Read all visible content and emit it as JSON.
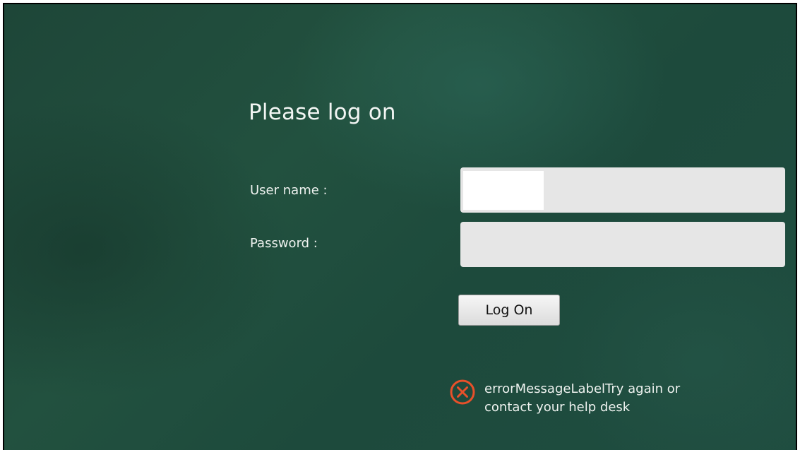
{
  "login": {
    "title": "Please log on",
    "username_label": "User name :",
    "password_label": "Password :",
    "username_value": "",
    "password_value": "",
    "logon_button_label": "Log On",
    "error_icon": "error-x-circle-icon",
    "error_message": "errorMessageLabelTry again or contact your help desk"
  },
  "colors": {
    "background": "#1f4d3f",
    "error_icon": "#e8502a",
    "input_background": "#e6e6e6"
  }
}
